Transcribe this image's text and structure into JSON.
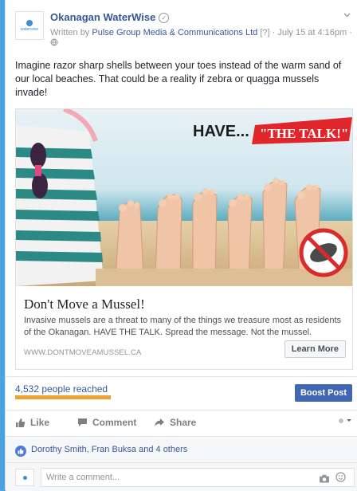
{
  "post": {
    "page_name": "Okanagan WaterWise",
    "verified_mark": "✓",
    "byline_prefix": "Written by ",
    "byline_author": "Pulse Group Media & Communications Ltd",
    "byline_suffix": " [?] · July 15 at 4:16pm ·",
    "body": "Imagine razor sharp shells between your toes instead of the warm sand of our local beaches. That could be a reality if zebra or quagga mussels invade!",
    "avatar_text": "waterwise"
  },
  "link": {
    "image_headline": "HAVE...",
    "image_tagline": "\"THE TALK!\"",
    "title": "Don't Move a Mussel!",
    "description": "Invasive mussels are a threat to many of the things we treasure most as residents of the Okanagan. HAVE THE TALK. Spread the message. Not the mussel.",
    "domain": "WWW.DONTMOVEAMUSSEL.CA",
    "cta_label": "Learn More"
  },
  "stats": {
    "reach": "4,532 people reached",
    "boost_label": "Boost Post"
  },
  "actions": {
    "like": "Like",
    "comment": "Comment",
    "share": "Share"
  },
  "likes": {
    "text": "Dorothy Smith, Fran Buksa and 4 others"
  },
  "comment_box": {
    "placeholder": "Write a comment..."
  },
  "colors": {
    "background": "#4aa3df",
    "link": "#365899",
    "boost": "#4267b2",
    "reach_underline": "#f0a030",
    "tagline_red": "#e0252b"
  }
}
